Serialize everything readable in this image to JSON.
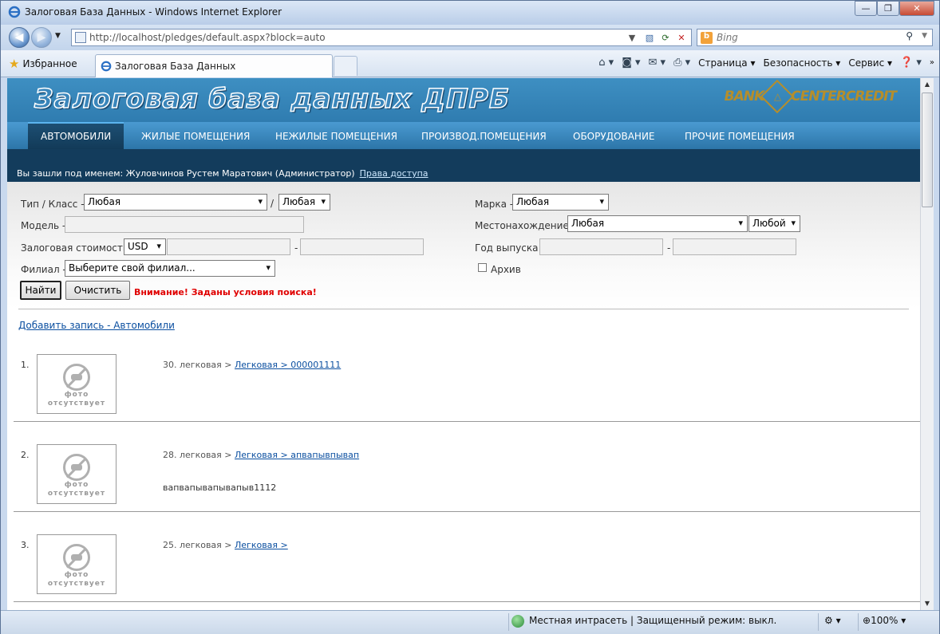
{
  "window": {
    "title": "Залоговая База Данных - Windows Internet Explorer",
    "address": "http://localhost/pledges/default.aspx?block=auto",
    "search_placeholder": "Bing",
    "favorites_label": "Избранное",
    "tab_title": "Залоговая База Данных",
    "cmd": {
      "page": "Страница",
      "security": "Безопасность",
      "service": "Сервис"
    }
  },
  "header": {
    "title": "Залоговая база данных ДПРБ",
    "logo_left": "BANK",
    "logo_right": "CENTERCREDIT"
  },
  "menu": {
    "items": [
      "АВТОМОБИЛИ",
      "ЖИЛЫЕ ПОМЕЩЕНИЯ",
      "НЕЖИЛЫЕ ПОМЕЩЕНИЯ",
      "ПРОИЗВОД.ПОМЕЩЕНИЯ",
      "ОБОРУДОВАНИЕ",
      "ПРОЧИЕ ПОМЕЩЕНИЯ"
    ]
  },
  "user": {
    "text": "Вы зашли под именем: Жуловчинов Рустем Маратович (Администратор)",
    "rights_link": "Права доступа"
  },
  "filters": {
    "type_label": "Тип / Класс -",
    "type_value": "Любая",
    "slash": "/",
    "class_value": "Любая",
    "model_label": "Модель -",
    "value_label": "Залоговая стоимость -",
    "currency": "USD",
    "dash": "-",
    "branch_label": "Филиал -",
    "branch_value": "Выберите свой филиал...",
    "brand_label": "Марка -",
    "brand_value": "Любая",
    "location_label": "Местонахождение -",
    "location_value": "Любая",
    "location_value2": "Любой",
    "year_label": "Год выпуска -",
    "archive_label": "Архив",
    "find_button": "Найти",
    "clear_button": "Очистить",
    "warning": "Внимание! Заданы условия поиска!"
  },
  "add_link": "Добавить запись - Автомобили",
  "records": [
    {
      "num": "1.",
      "prefix": "30. легковая >",
      "link": "Легковая > 000001111",
      "desc": "",
      "photo_caption": [
        "фото",
        "отсутствует"
      ]
    },
    {
      "num": "2.",
      "prefix": "28. легковая >",
      "link": "Легковая > апвапывпывап",
      "desc": "вапвапывапывапыв1112",
      "photo_caption": [
        "фото",
        "отсутствует"
      ]
    },
    {
      "num": "3.",
      "prefix": "25. легковая >",
      "link": "Легковая > ",
      "desc": "",
      "photo_caption": [
        "фото",
        "отсутствует"
      ]
    }
  ],
  "status": {
    "zone": "Местная интрасеть | Защищенный режим: выкл.",
    "zoom": "100%"
  }
}
